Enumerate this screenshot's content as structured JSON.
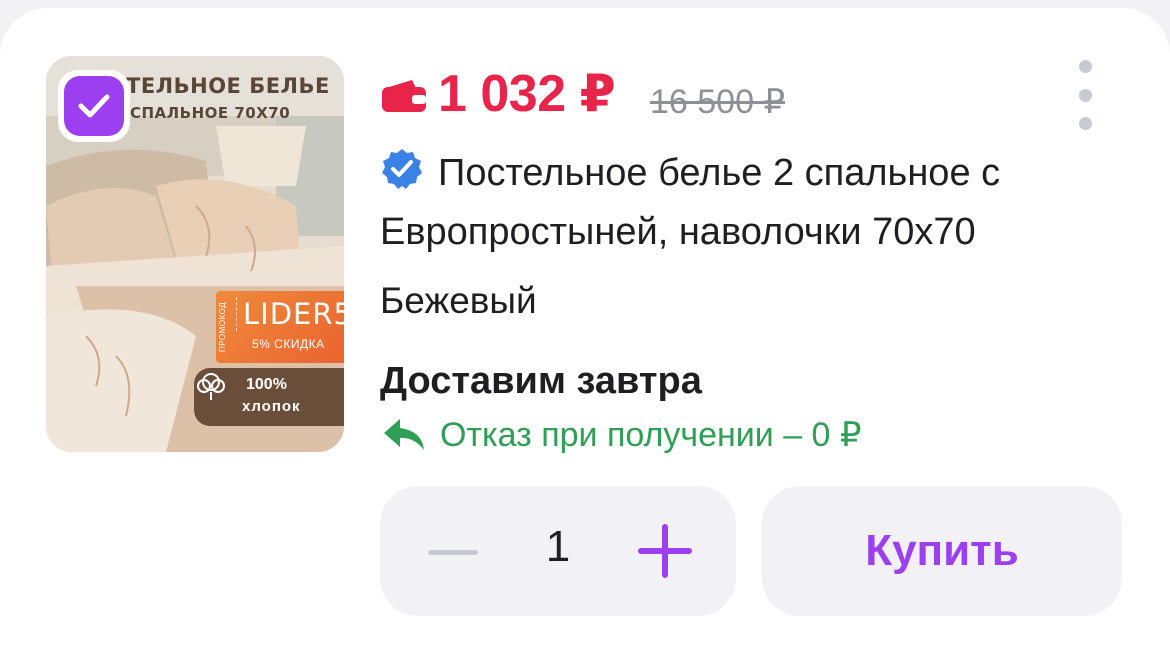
{
  "product": {
    "price": "1 032 ₽",
    "old_price": "16 500 ₽",
    "title": "Постельное белье 2 спальное с Европростыней, наволочки 70x70",
    "color": "Бежевый",
    "delivery": "Доставим завтра",
    "return_policy": "Отказ при получении – 0 ₽",
    "selected": true
  },
  "image": {
    "headline": "ТЕЛЬНОЕ БЕЛЬЕ",
    "subline": "СПАЛЬНОЕ 70X70",
    "promo_side": "ПРОМОКОД",
    "promo_code": "LIDER5",
    "promo_discount": "5% СКИДКА",
    "cotton_percent": "100%",
    "cotton_label": "хлопок"
  },
  "controls": {
    "quantity": "1",
    "buy_label": "Купить"
  },
  "colors": {
    "price": "#e8244a",
    "accent": "#9b3ff1",
    "return": "#2f9f55",
    "verified": "#3b82e6"
  },
  "icons": {
    "wallet": "wallet-icon",
    "verified": "verified-badge-icon",
    "return": "return-arrow-icon",
    "more": "more-vertical-icon",
    "check": "checkmark-icon",
    "plus": "plus-icon",
    "minus": "minus-icon",
    "cotton": "cotton-icon"
  }
}
